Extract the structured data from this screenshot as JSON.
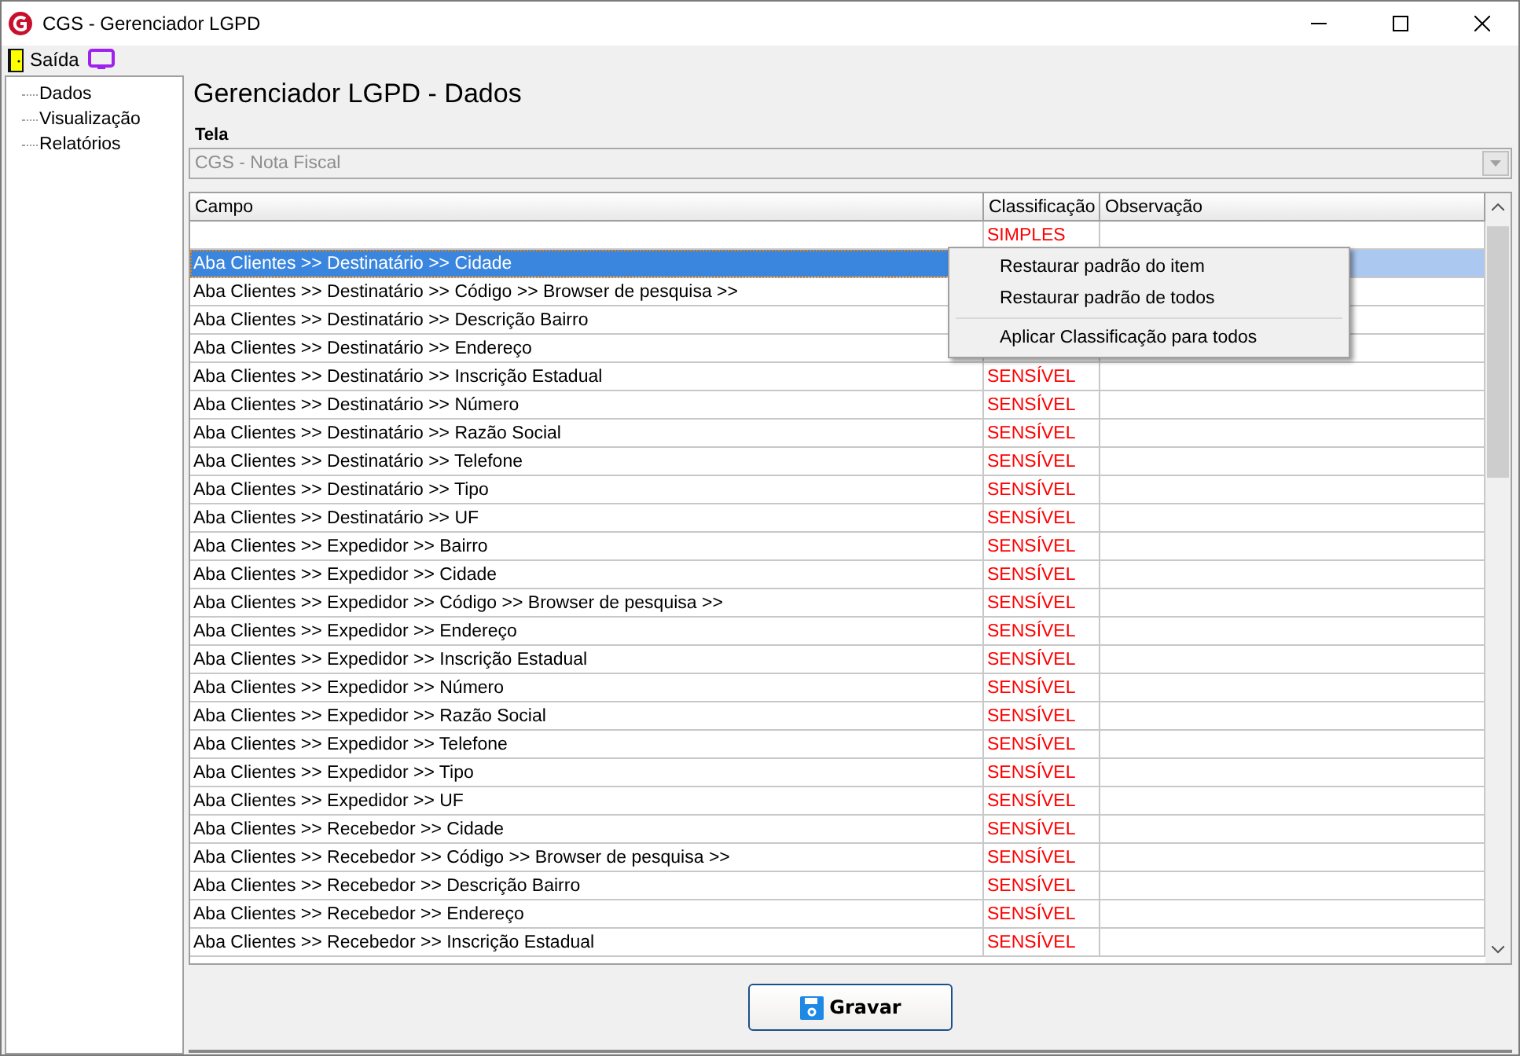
{
  "window": {
    "title": "CGS - Gerenciador LGPD"
  },
  "menu": {
    "exit_label": "Saída"
  },
  "sidebar": {
    "items": [
      {
        "label": "Dados",
        "selected": false
      },
      {
        "label": "Visualização",
        "selected": false
      },
      {
        "label": "Relatórios",
        "selected": false
      }
    ]
  },
  "heading": "Gerenciador LGPD - Dados",
  "screen_field": {
    "label": "Tela",
    "value": "CGS - Nota Fiscal",
    "disabled": true
  },
  "table": {
    "columns": [
      "Campo",
      "Classificação",
      "Observação"
    ],
    "rows": [
      {
        "campo": "",
        "classificacao": "SIMPLES",
        "selected": false
      },
      {
        "campo": "Aba Clientes >> Destinatário >> Cidade",
        "selected": true
      },
      {
        "campo": "Aba Clientes >> Destinatário >> Código >> Browser de pesquisa >>",
        "selected": false
      },
      {
        "campo": "Aba Clientes >> Destinatário >> Descrição Bairro",
        "selected": false
      },
      {
        "campo": "Aba Clientes >> Destinatário >> Endereço",
        "selected": false
      },
      {
        "campo": "Aba Clientes >> Destinatário >> Inscrição Estadual",
        "classificacao": "SENSÍVEL",
        "selected": false
      },
      {
        "campo": "Aba Clientes >> Destinatário >> Número",
        "classificacao": "SENSÍVEL",
        "selected": false
      },
      {
        "campo": "Aba Clientes >> Destinatário >> Razão Social",
        "classificacao": "SENSÍVEL",
        "selected": false
      },
      {
        "campo": "Aba Clientes >> Destinatário >> Telefone",
        "classificacao": "SENSÍVEL",
        "selected": false
      },
      {
        "campo": "Aba Clientes >> Destinatário >> Tipo",
        "classificacao": "SENSÍVEL",
        "selected": false
      },
      {
        "campo": "Aba Clientes >> Destinatário >> UF",
        "classificacao": "SENSÍVEL",
        "selected": false
      },
      {
        "campo": "Aba Clientes >> Expedidor >> Bairro",
        "classificacao": "SENSÍVEL",
        "selected": false
      },
      {
        "campo": "Aba Clientes >> Expedidor >> Cidade",
        "classificacao": "SENSÍVEL",
        "selected": false
      },
      {
        "campo": "Aba Clientes >> Expedidor >> Código >> Browser de pesquisa >>",
        "classificacao": "SENSÍVEL",
        "selected": false
      },
      {
        "campo": "Aba Clientes >> Expedidor >> Endereço",
        "classificacao": "SENSÍVEL",
        "selected": false
      },
      {
        "campo": "Aba Clientes >> Expedidor >> Inscrição Estadual",
        "classificacao": "SENSÍVEL",
        "selected": false
      },
      {
        "campo": "Aba Clientes >> Expedidor >> Número",
        "classificacao": "SENSÍVEL",
        "selected": false
      },
      {
        "campo": "Aba Clientes >> Expedidor >> Razão Social",
        "classificacao": "SENSÍVEL",
        "selected": false
      },
      {
        "campo": "Aba Clientes >> Expedidor >> Telefone",
        "classificacao": "SENSÍVEL",
        "selected": false
      },
      {
        "campo": "Aba Clientes >> Expedidor >> Tipo",
        "classificacao": "SENSÍVEL",
        "selected": false
      },
      {
        "campo": "Aba Clientes >> Expedidor >> UF",
        "classificacao": "SENSÍVEL",
        "selected": false
      },
      {
        "campo": "Aba Clientes >> Recebedor >> Cidade",
        "classificacao": "SENSÍVEL",
        "selected": false
      },
      {
        "campo": "Aba Clientes >> Recebedor >> Código >> Browser de pesquisa >>",
        "classificacao": "SENSÍVEL",
        "selected": false
      },
      {
        "campo": "Aba Clientes >> Recebedor >> Descrição Bairro",
        "classificacao": "SENSÍVEL",
        "selected": false
      },
      {
        "campo": "Aba Clientes >> Recebedor >> Endereço",
        "classificacao": "SENSÍVEL",
        "selected": false
      },
      {
        "campo": "Aba Clientes >> Recebedor >> Inscrição Estadual",
        "classificacao": "SENSÍVEL",
        "selected": false
      }
    ]
  },
  "context_menu": {
    "items": [
      {
        "kind": "item",
        "label": "Restaurar padrão do item"
      },
      {
        "kind": "item",
        "label": "Restaurar padrão de todos"
      },
      {
        "kind": "separator"
      },
      {
        "kind": "item",
        "label": "Aplicar Classificação para todos"
      }
    ]
  },
  "save_button": {
    "label": "Gravar"
  }
}
